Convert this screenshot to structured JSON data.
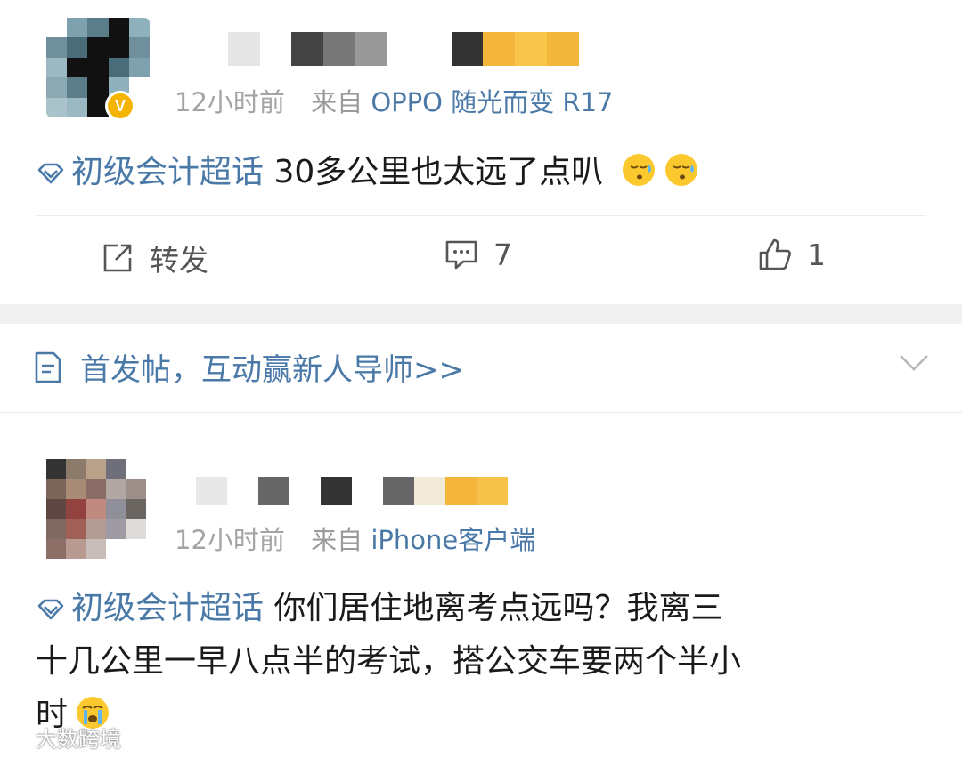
{
  "posts": [
    {
      "time": "12小时前",
      "source_prefix": "来自",
      "device": "OPPO 随光而变 R17",
      "topic": "初级会计超话",
      "text": "30多公里也太远了点叭",
      "emoji_count": 2
    },
    {
      "time": "12小时前",
      "source_prefix": "来自",
      "device": "iPhone客户端",
      "topic": "初级会计超话",
      "text_line1": "你们居住地离考点远吗？我离三",
      "text_line2": "十几公里一早八点半的考试，搭公交车要两个半小",
      "text_line3": "时"
    }
  ],
  "actions": {
    "repost_label": "转发",
    "comment_count": "7",
    "like_count": "1"
  },
  "guide": {
    "text": "首发帖，互动赢新人导师>>"
  },
  "watermark": {
    "text": "大数跨境"
  },
  "colors": {
    "link": "#4a79a8",
    "meta": "#a4a4a4",
    "badge": "#f5b400"
  }
}
